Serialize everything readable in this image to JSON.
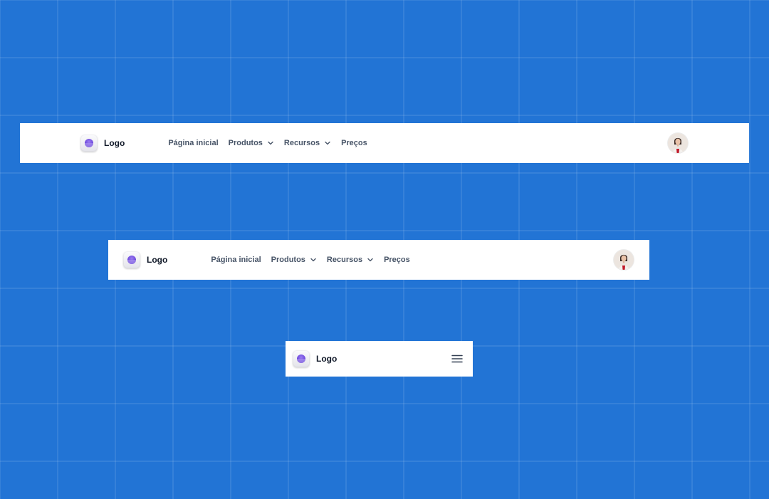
{
  "colors": {
    "background": "#2274d5",
    "navbar": "#ffffff",
    "logo_accent": "#6b46dc",
    "link_text": "#475467",
    "brand_text": "#101828"
  },
  "brand": {
    "logo_icon": "purple-orb-logo-icon",
    "label": "Logo"
  },
  "nav": {
    "items": [
      {
        "label": "Página inicial",
        "has_dropdown": false
      },
      {
        "label": "Produtos",
        "has_dropdown": true,
        "icon": "chevron-down-icon"
      },
      {
        "label": "Recursos",
        "has_dropdown": true,
        "icon": "chevron-down-icon"
      },
      {
        "label": "Preços",
        "has_dropdown": false
      }
    ]
  },
  "user": {
    "avatar_icon": "user-avatar-photo"
  },
  "mobile": {
    "menu_icon": "hamburger-menu-icon"
  }
}
